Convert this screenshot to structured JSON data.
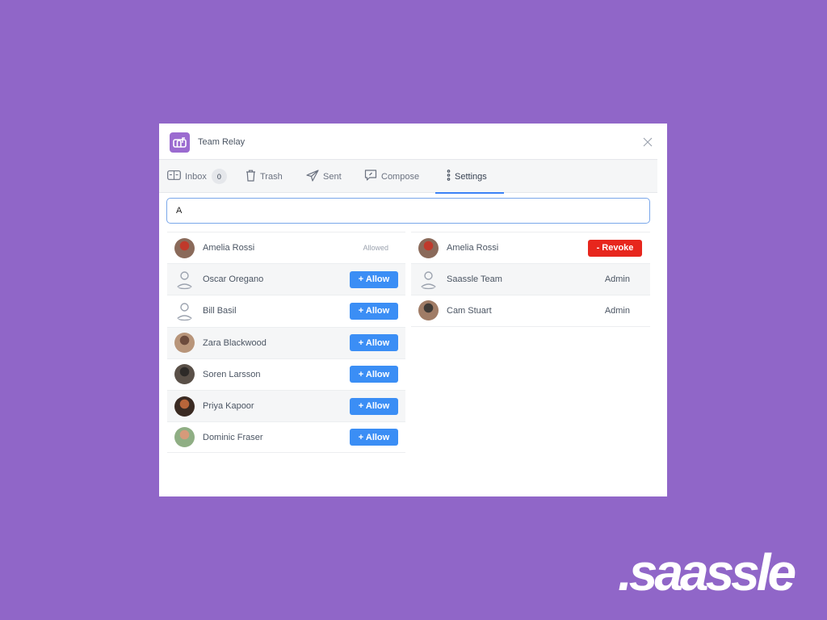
{
  "window": {
    "title": "Team Relay",
    "logo_icon": "mailbox-icon",
    "close_icon": "close-icon"
  },
  "tabs": [
    {
      "label": "Inbox",
      "icon": "inbox-icon",
      "badge": "0",
      "active": false
    },
    {
      "label": "Trash",
      "icon": "trash-icon",
      "active": false
    },
    {
      "label": "Sent",
      "icon": "send-icon",
      "active": false
    },
    {
      "label": "Compose",
      "icon": "compose-icon",
      "active": false
    },
    {
      "label": "Settings",
      "icon": "more-vertical-icon",
      "active": true
    }
  ],
  "search": {
    "value": "A",
    "placeholder": ""
  },
  "candidates": [
    {
      "name": "Amelia Rossi",
      "avatar": "photo",
      "status": "Allowed"
    },
    {
      "name": "Oscar Oregano",
      "avatar": "placeholder",
      "action": "+ Allow"
    },
    {
      "name": "Bill Basil",
      "avatar": "placeholder",
      "action": "+ Allow"
    },
    {
      "name": "Zara Blackwood",
      "avatar": "photo",
      "action": "+ Allow"
    },
    {
      "name": "Soren Larsson",
      "avatar": "photo",
      "action": "+ Allow"
    },
    {
      "name": "Priya Kapoor",
      "avatar": "photo",
      "action": "+ Allow"
    },
    {
      "name": "Dominic Fraser",
      "avatar": "photo",
      "action": "+ Allow"
    }
  ],
  "members": [
    {
      "name": "Amelia Rossi",
      "avatar": "photo",
      "action": "- Revoke"
    },
    {
      "name": "Saassle Team",
      "avatar": "placeholder",
      "role": "Admin"
    },
    {
      "name": "Cam Stuart",
      "avatar": "photo",
      "role": "Admin"
    }
  ],
  "brand": {
    "text": ".saassle"
  },
  "colors": {
    "background": "#9066c8",
    "accent": "#3b8ef5",
    "danger": "#e7261d",
    "logo": "#9b6bd0",
    "tab_underline": "#3b82f6"
  }
}
